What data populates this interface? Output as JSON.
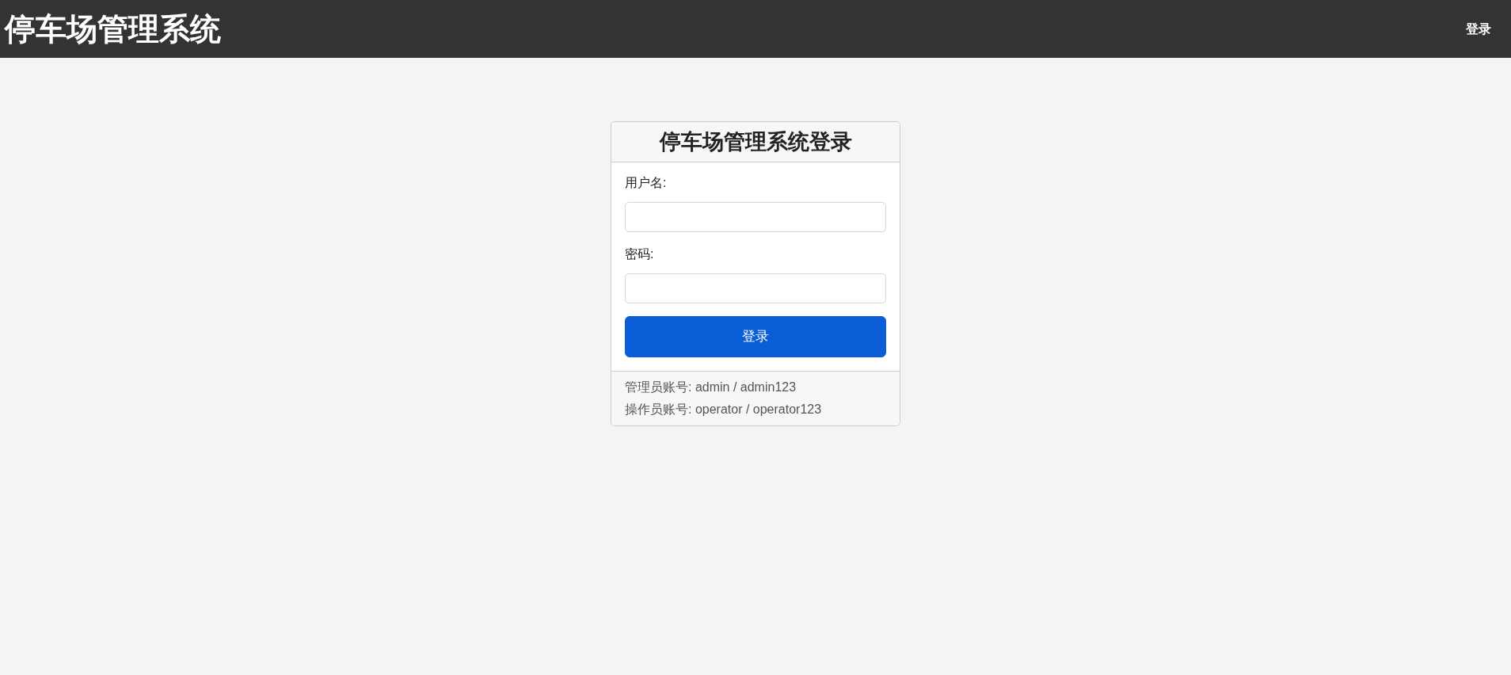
{
  "header": {
    "title": "停车场管理系统",
    "nav_link": "登录"
  },
  "login_card": {
    "title": "停车场管理系统登录",
    "fields": [
      {
        "label": "用户名:"
      },
      {
        "label": "密码:"
      }
    ],
    "submit": "登录",
    "footer_lines": [
      "管理员账号: admin / admin123",
      "操作员账号: operator / operator123"
    ]
  }
}
